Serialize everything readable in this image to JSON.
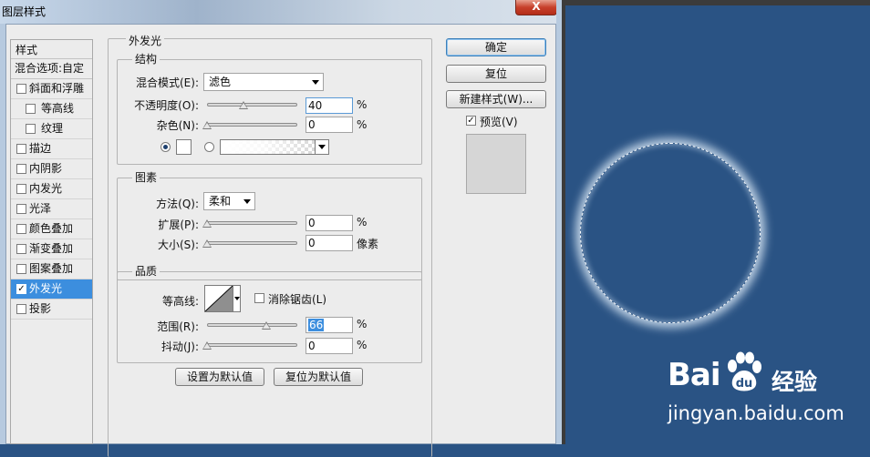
{
  "window": {
    "title": "图层样式",
    "close_label": "X"
  },
  "style_list": {
    "header": "样式",
    "blend_options": "混合选项:自定",
    "items": [
      {
        "label": "斜面和浮雕",
        "checked": false,
        "indent": false
      },
      {
        "label": "等高线",
        "checked": false,
        "indent": true
      },
      {
        "label": "纹理",
        "checked": false,
        "indent": true
      },
      {
        "label": "描边",
        "checked": false,
        "indent": false
      },
      {
        "label": "内阴影",
        "checked": false,
        "indent": false
      },
      {
        "label": "内发光",
        "checked": false,
        "indent": false
      },
      {
        "label": "光泽",
        "checked": false,
        "indent": false
      },
      {
        "label": "颜色叠加",
        "checked": false,
        "indent": false
      },
      {
        "label": "渐变叠加",
        "checked": false,
        "indent": false
      },
      {
        "label": "图案叠加",
        "checked": false,
        "indent": false
      },
      {
        "label": "外发光",
        "checked": true,
        "indent": false,
        "selected": true
      },
      {
        "label": "投影",
        "checked": false,
        "indent": false
      }
    ]
  },
  "outer_glow": {
    "section_title": "外发光",
    "structure": {
      "title": "结构",
      "blend_mode_label": "混合模式(E):",
      "blend_mode_value": "滤色",
      "opacity_label": "不透明度(O):",
      "opacity_value": "40",
      "opacity_fraction": 0.4,
      "noise_label": "杂色(N):",
      "noise_value": "0",
      "noise_fraction": 0.0,
      "percent": "%"
    },
    "elements": {
      "title": "图素",
      "technique_label": "方法(Q):",
      "technique_value": "柔和",
      "spread_label": "扩展(P):",
      "spread_value": "0",
      "spread_fraction": 0.0,
      "size_label": "大小(S):",
      "size_value": "0",
      "size_fraction": 0.0,
      "size_unit": "像素",
      "percent": "%"
    },
    "quality": {
      "title": "品质",
      "contour_label": "等高线:",
      "antialias_label": "消除锯齿(L)",
      "antialias_checked": false,
      "range_label": "范围(R):",
      "range_value": "66",
      "range_fraction": 0.66,
      "jitter_label": "抖动(J):",
      "jitter_value": "0",
      "jitter_fraction": 0.0,
      "percent": "%"
    },
    "make_default": "设置为默认值",
    "reset_default": "复位为默认值"
  },
  "actions": {
    "ok": "确定",
    "reset": "复位",
    "new_style": "新建样式(W)...",
    "preview_label": "预览(V)",
    "preview_checked": true
  },
  "watermark": {
    "logo_text_a": "Bai",
    "logo_text_b": "du",
    "logo_cn": "经验",
    "url": "jingyan.baidu.com"
  },
  "colors": {
    "selection": "#3c8ede",
    "canvas_bg": "#2a5384",
    "glow": "#d7e6f5"
  }
}
